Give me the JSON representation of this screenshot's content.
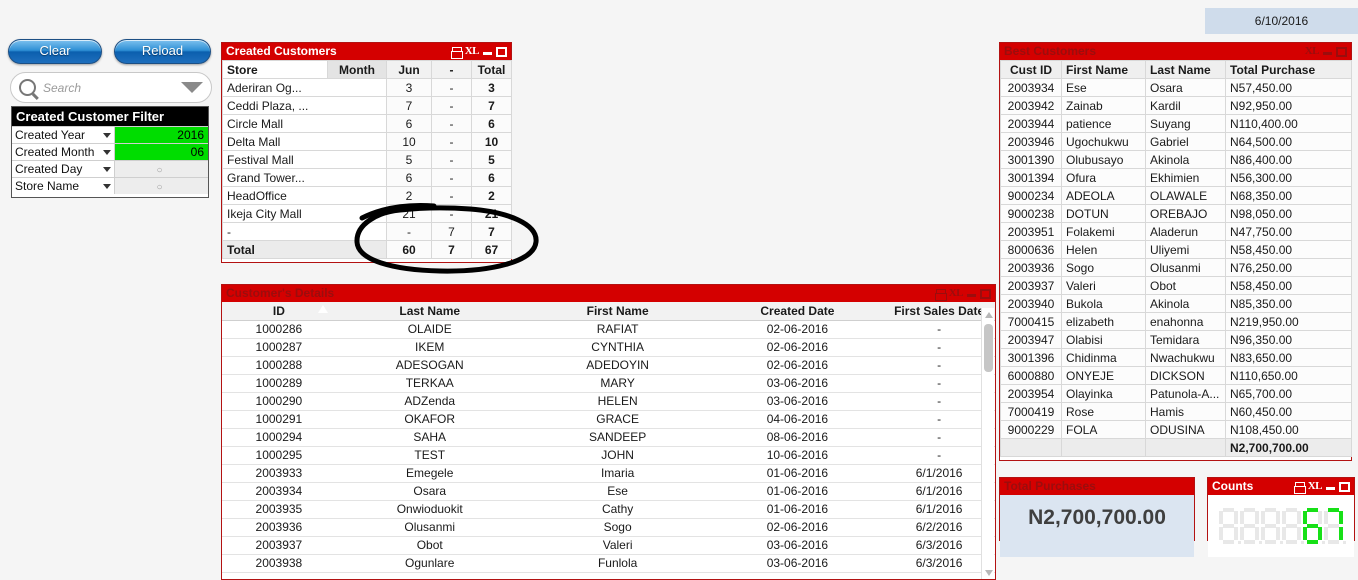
{
  "header": {
    "date": "6/10/2016"
  },
  "toolbar": {
    "clear_label": "Clear",
    "reload_label": "Reload",
    "search_placeholder": "Search"
  },
  "filter_panel": {
    "title": "Created Customer Filter",
    "rows": [
      {
        "label": "Created Year",
        "value": "2016",
        "state": "selected"
      },
      {
        "label": "Created Month",
        "value": "06",
        "state": "selected"
      },
      {
        "label": "Created Day",
        "value": "",
        "state": "empty"
      },
      {
        "label": "Store Name",
        "value": "",
        "state": "empty"
      }
    ]
  },
  "created_customers": {
    "title": "Created Customers",
    "window_icons": [
      "print-icon",
      "excel-icon",
      "minimize-icon",
      "maximize-icon"
    ],
    "columns": [
      "Store",
      "Month",
      "Jun",
      "-",
      "Total"
    ],
    "rows": [
      {
        "store": "Aderiran Og...",
        "jun": "3",
        "dash": "-",
        "total": "3"
      },
      {
        "store": "Ceddi Plaza, ...",
        "jun": "7",
        "dash": "-",
        "total": "7"
      },
      {
        "store": "Circle Mall",
        "jun": "6",
        "dash": "-",
        "total": "6"
      },
      {
        "store": "Delta Mall",
        "jun": "10",
        "dash": "-",
        "total": "10"
      },
      {
        "store": "Festival Mall",
        "jun": "5",
        "dash": "-",
        "total": "5"
      },
      {
        "store": "Grand Tower...",
        "jun": "6",
        "dash": "-",
        "total": "6"
      },
      {
        "store": "HeadOffice",
        "jun": "2",
        "dash": "-",
        "total": "2"
      },
      {
        "store": "Ikeja City Mall",
        "jun": "21",
        "dash": "-",
        "total": "21"
      },
      {
        "store": "-",
        "jun": "-",
        "dash": "7",
        "total": "7"
      }
    ],
    "total_row": {
      "store": "Total",
      "jun": "60",
      "dash": "7",
      "total": "67"
    }
  },
  "best_customers": {
    "title": "Best Customers",
    "window_icons": [
      "excel-icon",
      "minimize-icon",
      "maximize-icon"
    ],
    "columns": [
      "Cust ID",
      "First Name",
      "Last Name",
      "Total Purchase"
    ],
    "rows": [
      [
        "2003934",
        "Ese",
        "Osara",
        "N57,450.00"
      ],
      [
        "2003942",
        "Zainab",
        "Kardil",
        "N92,950.00"
      ],
      [
        "2003944",
        "patience",
        "Suyang",
        "N110,400.00"
      ],
      [
        "2003946",
        "Ugochukwu",
        "Gabriel",
        "N64,500.00"
      ],
      [
        "3001390",
        "Olubusayo",
        "Akinola",
        "N86,400.00"
      ],
      [
        "3001394",
        "Ofura",
        "Ekhimien",
        "N56,300.00"
      ],
      [
        "9000234",
        "ADEOLA",
        "OLAWALE",
        "N68,350.00"
      ],
      [
        "9000238",
        "DOTUN",
        "OREBAJO",
        "N98,050.00"
      ],
      [
        "2003951",
        "Folakemi",
        "Aladerun",
        "N47,750.00"
      ],
      [
        "8000636",
        "Helen",
        "Uliyemi",
        "N58,450.00"
      ],
      [
        "2003936",
        "Sogo",
        "Olusanmi",
        "N76,250.00"
      ],
      [
        "2003937",
        "Valeri",
        "Obot",
        "N58,450.00"
      ],
      [
        "2003940",
        "Bukola",
        "Akinola",
        "N85,350.00"
      ],
      [
        "7000415",
        "elizabeth",
        "enahonna",
        "N219,950.00"
      ],
      [
        "2003947",
        "Olabisi",
        "Temidara",
        "N96,350.00"
      ],
      [
        "3001396",
        "Chidinma",
        "Nwachukwu",
        "N83,650.00"
      ],
      [
        "6000880",
        "ONYEJE",
        "DICKSON",
        "N110,650.00"
      ],
      [
        "2003954",
        "Olayinka",
        "Patunola-A...",
        "N65,700.00"
      ],
      [
        "7000419",
        "Rose",
        "Hamis",
        "N60,450.00"
      ],
      [
        "9000229",
        "FOLA",
        "ODUSINA",
        "N108,450.00"
      ]
    ],
    "grand_total": "N2,700,700.00"
  },
  "customer_details": {
    "title": "Customer's Details",
    "window_icons": [
      "print-icon",
      "excel-icon",
      "minimize-icon",
      "maximize-icon"
    ],
    "columns": [
      "ID",
      "Last Name",
      "First Name",
      "Created Date",
      "First Sales Date"
    ],
    "sorted_column": "ID",
    "rows": [
      [
        "1000286",
        "OLAIDE",
        "RAFIAT",
        "02-06-2016",
        "-"
      ],
      [
        "1000287",
        "IKEM",
        "CYNTHIA",
        "02-06-2016",
        "-"
      ],
      [
        "1000288",
        "ADESOGAN",
        "ADEDOYIN",
        "02-06-2016",
        "-"
      ],
      [
        "1000289",
        "TERKAA",
        "MARY",
        "03-06-2016",
        "-"
      ],
      [
        "1000290",
        "ADZenda",
        "HELEN",
        "03-06-2016",
        "-"
      ],
      [
        "1000291",
        "OKAFOR",
        "GRACE",
        "04-06-2016",
        "-"
      ],
      [
        "1000294",
        "SAHA",
        "SANDEEP",
        "08-06-2016",
        "-"
      ],
      [
        "1000295",
        "TEST",
        "JOHN",
        "10-06-2016",
        "-"
      ],
      [
        "2003933",
        "Emegele",
        "Imaria",
        "01-06-2016",
        "6/1/2016"
      ],
      [
        "2003934",
        "Osara",
        "Ese",
        "01-06-2016",
        "6/1/2016"
      ],
      [
        "2003935",
        "Onwioduokit",
        "Cathy",
        "01-06-2016",
        "6/1/2016"
      ],
      [
        "2003936",
        "Olusanmi",
        "Sogo",
        "02-06-2016",
        "6/2/2016"
      ],
      [
        "2003937",
        "Obot",
        "Valeri",
        "03-06-2016",
        "6/3/2016"
      ],
      [
        "2003938",
        "Ogunlare",
        "Funlola",
        "03-06-2016",
        "6/3/2016"
      ]
    ]
  },
  "total_purchases": {
    "title": "Total Purchases",
    "value": "N2,700,700.00"
  },
  "counts": {
    "title": "Counts",
    "window_icons": [
      "print-icon",
      "excel-icon",
      "minimize-icon",
      "maximize-icon"
    ],
    "value": "67",
    "digit_slots": 6,
    "lit_color": "#17e017",
    "unlit_color": "#e8e8e8"
  }
}
